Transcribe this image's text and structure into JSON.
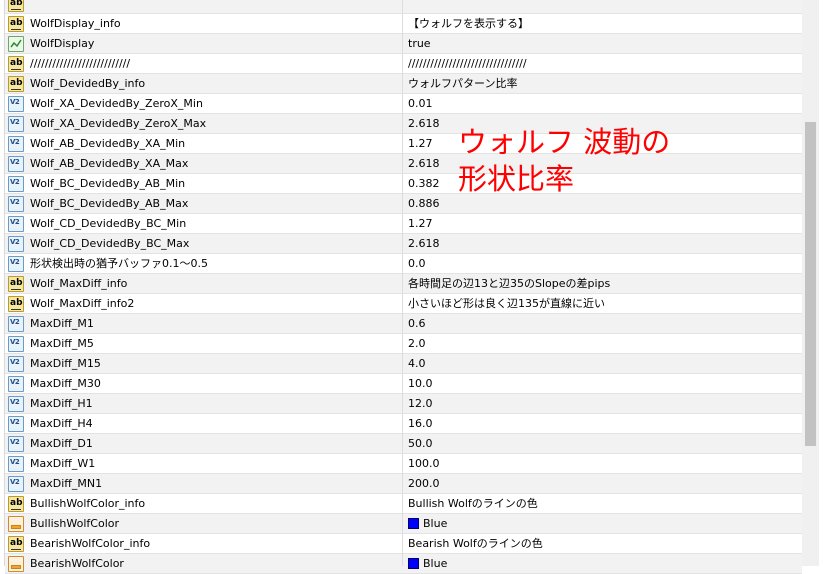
{
  "rows": [
    {
      "name": "",
      "value": "",
      "icon": "ab-icon",
      "partial": true
    },
    {
      "name": "WolfDisplay_info",
      "value": "【ウォルフを表示する】",
      "icon": "ab-icon"
    },
    {
      "name": "WolfDisplay",
      "value": "true",
      "icon": "bool-icon"
    },
    {
      "name": "///////////////////////////",
      "value": "////////////////////////////////",
      "icon": "ab-icon"
    },
    {
      "name": "Wolf_DevidedBy_info",
      "value": "ウォルフパターン比率",
      "icon": "ab-icon"
    },
    {
      "name": "Wolf_XA_DevidedBy_ZeroX_Min",
      "value": "0.01",
      "icon": "value-icon"
    },
    {
      "name": "Wolf_XA_DevidedBy_ZeroX_Max",
      "value": "2.618",
      "icon": "value-icon"
    },
    {
      "name": "Wolf_AB_DevidedBy_XA_Min",
      "value": "1.27",
      "icon": "value-icon"
    },
    {
      "name": "Wolf_AB_DevidedBy_XA_Max",
      "value": "2.618",
      "icon": "value-icon"
    },
    {
      "name": "Wolf_BC_DevidedBy_AB_Min",
      "value": "0.382",
      "icon": "value-icon"
    },
    {
      "name": "Wolf_BC_DevidedBy_AB_Max",
      "value": "0.886",
      "icon": "value-icon"
    },
    {
      "name": "Wolf_CD_DevidedBy_BC_Min",
      "value": "1.27",
      "icon": "value-icon"
    },
    {
      "name": "Wolf_CD_DevidedBy_BC_Max",
      "value": "2.618",
      "icon": "value-icon"
    },
    {
      "name": "形状検出時の猶予バッファ0.1～0.5",
      "value": "0.0",
      "icon": "value-icon"
    },
    {
      "name": "Wolf_MaxDiff_info",
      "value": "各時間足の辺13と辺35のSlopeの差pips",
      "icon": "ab-icon"
    },
    {
      "name": "Wolf_MaxDiff_info2",
      "value": "小さいほど形は良く辺135が直線に近い",
      "icon": "ab-icon"
    },
    {
      "name": "MaxDiff_M1",
      "value": "0.6",
      "icon": "value-icon"
    },
    {
      "name": "MaxDiff_M5",
      "value": "2.0",
      "icon": "value-icon"
    },
    {
      "name": "MaxDiff_M15",
      "value": "4.0",
      "icon": "value-icon"
    },
    {
      "name": "MaxDiff_M30",
      "value": "10.0",
      "icon": "value-icon"
    },
    {
      "name": "MaxDiff_H1",
      "value": "12.0",
      "icon": "value-icon"
    },
    {
      "name": "MaxDiff_H4",
      "value": "16.0",
      "icon": "value-icon"
    },
    {
      "name": "MaxDiff_D1",
      "value": "50.0",
      "icon": "value-icon"
    },
    {
      "name": "MaxDiff_W1",
      "value": "100.0",
      "icon": "value-icon"
    },
    {
      "name": "MaxDiff_MN1",
      "value": "200.0",
      "icon": "value-icon"
    },
    {
      "name": "BullishWolfColor_info",
      "value": "Bullish Wolfのラインの色",
      "icon": "ab-icon"
    },
    {
      "name": "BullishWolfColor",
      "value": "Blue",
      "icon": "color-icon",
      "swatch": "#0000ff"
    },
    {
      "name": "BearishWolfColor_info",
      "value": "Bearish Wolfのラインの色",
      "icon": "ab-icon"
    },
    {
      "name": "BearishWolfColor",
      "value": "Blue",
      "icon": "color-icon",
      "swatch": "#0000ff"
    }
  ],
  "annotation": {
    "line1": "ウォルフ 波動の",
    "line2": "形状比率",
    "color": "#ff0000"
  },
  "colors": {
    "alt_row": "#f2f2f2",
    "grid_line": "#e3e3e3",
    "scrollbar": "#f0f0f0",
    "thumb": "#c2c2c2"
  }
}
